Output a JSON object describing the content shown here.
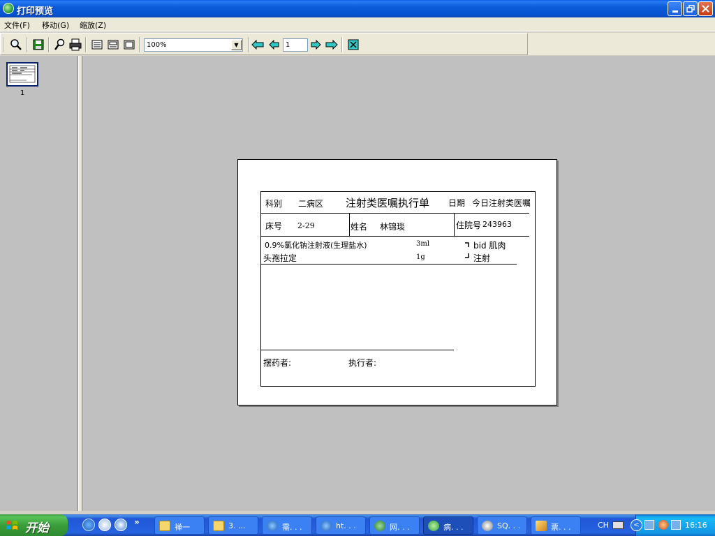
{
  "window": {
    "title": "打印预览"
  },
  "menu": [
    {
      "label": "文件(F)"
    },
    {
      "label": "移动(G)"
    },
    {
      "label": "缩放(Z)"
    }
  ],
  "toolbar": {
    "zoom_value": "100%",
    "page_value": "1",
    "icons": [
      "zoom-icon",
      "save-icon",
      "page-setup-icon",
      "print-icon",
      "one-page-icon",
      "two-page-icon",
      "multi-page-icon",
      "first-page-icon",
      "prev-page-icon",
      "next-page-icon",
      "last-page-icon",
      "close-preview-icon"
    ]
  },
  "thumbnails": [
    {
      "number": "1"
    }
  ],
  "document": {
    "dept_label": "科别",
    "dept_value": "二病区",
    "title": "注射类医嘱执行单",
    "date_label": "日期",
    "date_value": "今日注射类医嘱",
    "bed_label": "床号",
    "bed_value": "2-29",
    "name_label": "姓名",
    "name_value": "林锦琰",
    "admission_label": "住院号",
    "admission_value": "243963",
    "drugs": [
      {
        "name": "0.9%氯化钠注射液(生理盐水)",
        "dose": "3ml"
      },
      {
        "name": "头孢拉定",
        "dose": "1g"
      }
    ],
    "usage_line1": "bid 肌肉",
    "usage_line2": "注射",
    "dispenser_label": "摆药者:",
    "executor_label": "执行者:"
  },
  "taskbar": {
    "start_label": "开始",
    "overflow": "»",
    "tasks": [
      {
        "label": "禅一"
      },
      {
        "label": "3. ..."
      },
      {
        "label": "需. . ."
      },
      {
        "label": "ht. . ."
      },
      {
        "label": "网. . ."
      },
      {
        "label": "病. . ."
      },
      {
        "label": "SQ. . ."
      },
      {
        "label": "票. . ."
      }
    ],
    "language": "CH",
    "clock": "16:16"
  }
}
